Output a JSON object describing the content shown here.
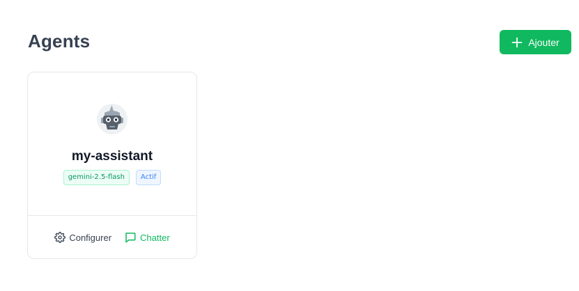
{
  "header": {
    "title": "Agents",
    "add_label": "Ajouter"
  },
  "agent": {
    "name": "my-assistant",
    "model": "gemini-2.5-flash",
    "status": "Actif",
    "avatar_icon": "robot-icon"
  },
  "actions": {
    "configure_label": "Configurer",
    "chat_label": "Chatter"
  },
  "colors": {
    "accent": "#10b95f",
    "status_blue": "#3b82f6"
  }
}
